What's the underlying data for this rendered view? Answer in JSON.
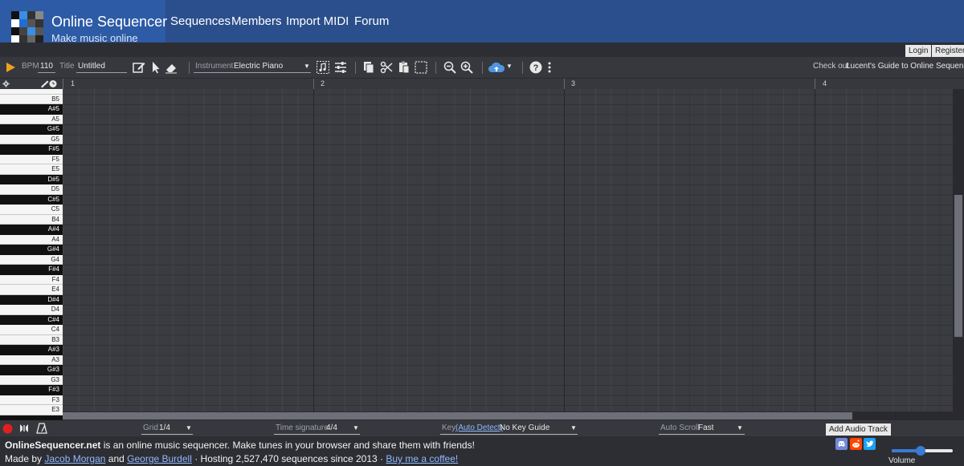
{
  "header": {
    "title": "Online Sequencer",
    "subtitle": "Make music online",
    "nav": [
      "Sequences",
      "Members",
      "Import MIDI",
      "Forum"
    ],
    "brand_color": "#2b4f8c",
    "logo_color": "#2d5ba6"
  },
  "auth": {
    "login": "Login",
    "register": "Register"
  },
  "toolbar": {
    "bpm_label": "BPM",
    "bpm_value": "110",
    "title_label": "Title",
    "title_value": "Untitled",
    "instrument_label": "Instrument",
    "instrument_value": "Electric Piano",
    "promo_prefix": "Check out",
    "promo_link": "Lucent's Guide to Online Sequencer",
    "icons": [
      "play-icon",
      "pencil-icon",
      "pointer-icon",
      "eraser-icon",
      "note-select-icon",
      "sliders-icon",
      "copy-icon",
      "cut-icon",
      "paste-icon",
      "select-box-icon",
      "zoom-out-icon",
      "zoom-in-icon",
      "cloud-upload-icon",
      "help-icon",
      "more-icon"
    ]
  },
  "ruler": {
    "measures": [
      "1",
      "2",
      "3",
      "4"
    ]
  },
  "keys": [
    "B5",
    "A#5",
    "A5",
    "G#5",
    "G5",
    "F#5",
    "F5",
    "E5",
    "D#5",
    "D5",
    "C#5",
    "C5",
    "B4",
    "A#4",
    "A4",
    "G#4",
    "G4",
    "F#4",
    "F4",
    "E4",
    "D#4",
    "D4",
    "C#4",
    "C4",
    "B3",
    "A#3",
    "A3",
    "G#3",
    "G3",
    "F#3",
    "F3",
    "E3"
  ],
  "bottombar": {
    "grid_label": "Grid",
    "grid_value": "1/4",
    "timesig_label": "Time signature",
    "timesig_value": "4/4",
    "key_label": "Key",
    "key_auto": "(Auto Detect)",
    "key_value": "No Key Guide",
    "autoscroll_label": "Auto Scroll",
    "autoscroll_value": "Fast",
    "add_audio_track": "Add Audio Track"
  },
  "footer": {
    "site_name": "OnlineSequencer.net",
    "tagline": " is an online music sequencer. Make tunes in your browser and share them with friends!",
    "made_by": "Made by",
    "author1": "Jacob Morgan",
    "and": "and",
    "author2": "George Burdell",
    "hosting": "· Hosting 2,527,470 sequences since 2013 ·",
    "coffee": "Buy me a coffee!",
    "volume_label": "Volume",
    "volume_level": 0.47
  }
}
